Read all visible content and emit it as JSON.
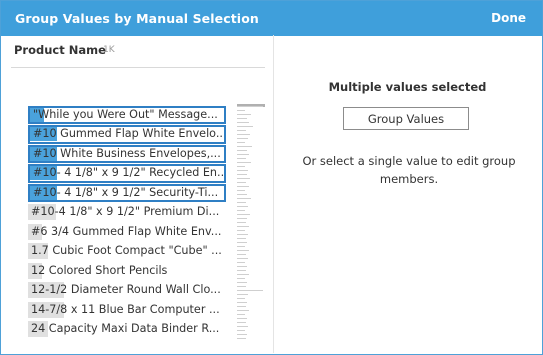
{
  "dialog": {
    "title": "Group Values by Manual Selection",
    "done_label": "Done",
    "accent_color": "#3f9fdb"
  },
  "field": {
    "name": "Product Name",
    "count": "1K"
  },
  "values": [
    {
      "text": "\"While you Were Out\" Message...",
      "selected": true,
      "bar": 0.07
    },
    {
      "text": "#10 Gummed Flap White Envelo...",
      "selected": true,
      "bar": 0.14
    },
    {
      "text": "#10 White Business Envelopes,...",
      "selected": true,
      "bar": 0.14
    },
    {
      "text": "#10- 4 1/8\" x 9 1/2\" Recycled En...",
      "selected": true,
      "bar": 0.14
    },
    {
      "text": "#10- 4 1/8\" x 9 1/2\" Security-Ti...",
      "selected": true,
      "bar": 0.14
    },
    {
      "text": "#10-4 1/8\" x 9 1/2\" Premium Di...",
      "selected": false,
      "bar": 0.14
    },
    {
      "text": "#6 3/4 Gummed Flap White Env...",
      "selected": false,
      "bar": 0.07
    },
    {
      "text": "1.7 Cubic Foot Compact \"Cube\" ...",
      "selected": false,
      "bar": 0.1
    },
    {
      "text": "12 Colored Short Pencils",
      "selected": false,
      "bar": 0.07
    },
    {
      "text": "12-1/2 Diameter Round Wall Clo...",
      "selected": false,
      "bar": 0.18
    },
    {
      "text": "14-7/8 x 11 Blue Bar Computer ...",
      "selected": false,
      "bar": 0.18
    },
    {
      "text": "24 Capacity Maxi Data Binder R...",
      "selected": false,
      "bar": 0.1
    }
  ],
  "right_panel": {
    "title": "Multiple values selected",
    "button_label": "Group Values",
    "hint": "Or select a single value to edit group members."
  }
}
